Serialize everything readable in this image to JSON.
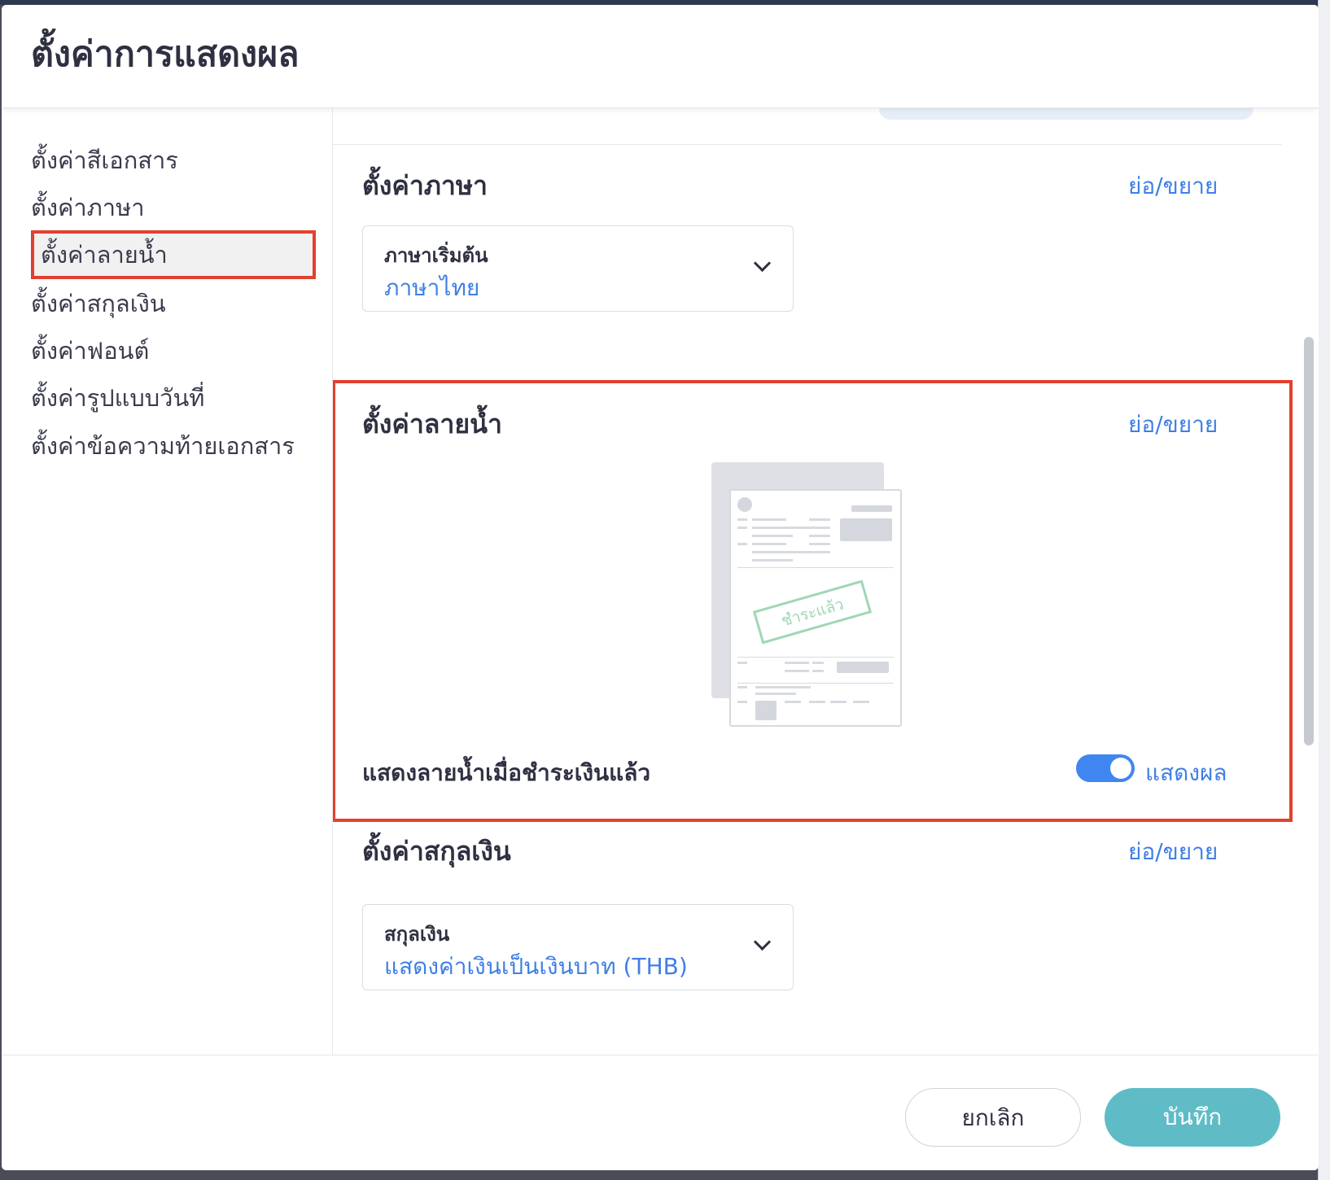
{
  "modal": {
    "title": "ตั้งค่าการแสดงผล"
  },
  "sidebar": {
    "items": [
      {
        "label": "ตั้งค่าสีเอกสาร"
      },
      {
        "label": "ตั้งค่าภาษา"
      },
      {
        "label": "ตั้งค่าลายน้ำ",
        "active": true
      },
      {
        "label": "ตั้งค่าสกุลเงิน"
      },
      {
        "label": "ตั้งค่าฟอนต์"
      },
      {
        "label": "ตั้งค่ารูปแบบวันที่"
      },
      {
        "label": "ตั้งค่าข้อความท้ายเอกสาร"
      }
    ]
  },
  "language_section": {
    "title": "ตั้งค่าภาษา",
    "toggle_label": "ย่อ/ขยาย",
    "select": {
      "label": "ภาษาเริ่มต้น",
      "value": "ภาษาไทย"
    }
  },
  "watermark_section": {
    "title": "ตั้งค่าลายน้ำ",
    "toggle_label": "ย่อ/ขยาย",
    "stamp_text": "ชำระแล้ว",
    "option_label": "แสดงลายน้ำเมื่อชำระเงินแล้ว",
    "switch_on": true,
    "switch_text": "แสดงผล"
  },
  "currency_section": {
    "title": "ตั้งค่าสกุลเงิน",
    "toggle_label": "ย่อ/ขยาย",
    "select": {
      "label": "สกุลเงิน",
      "value": "แสดงค่าเงินเป็นเงินบาท (THB)"
    }
  },
  "footer": {
    "cancel_label": "ยกเลิก",
    "save_label": "บันทึก"
  },
  "colors": {
    "accent_blue": "#3f7fe6",
    "highlight_red": "#e2412f",
    "save_button": "#5fbcc6",
    "stamp_green": "#9fd7b4"
  }
}
